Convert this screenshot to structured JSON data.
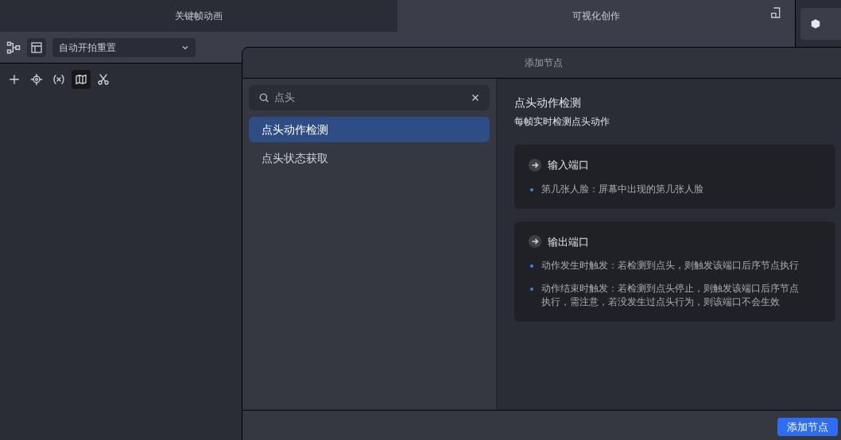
{
  "tabs": [
    {
      "label": "关键帧动画",
      "selected": false
    },
    {
      "label": "可视化创作",
      "selected": true
    }
  ],
  "toolbar": {
    "dropdown": "自动开拍重置"
  },
  "tools": [
    {
      "kind": "add",
      "selected": false
    },
    {
      "kind": "target",
      "selected": false
    },
    {
      "kind": "variable",
      "selected": false
    },
    {
      "kind": "map",
      "selected": true
    },
    {
      "kind": "cut",
      "selected": false
    }
  ],
  "dialog": {
    "title": "添加节点",
    "search": {
      "value": "点头"
    },
    "results": [
      {
        "label": "点头动作检测",
        "selected": true
      },
      {
        "label": "点头状态获取",
        "selected": false
      }
    ],
    "detail": {
      "title": "点头动作检测",
      "subtitle": "每帧实时检测点头动作",
      "sections": [
        {
          "title": "输入端口",
          "items": [
            "第几张人脸：屏幕中出现的第几张人脸"
          ]
        },
        {
          "title": "输出端口",
          "items": [
            "动作发生时触发：若检测到点头，则触发该端口后序节点执行",
            "动作结束时触发：若检测到点头停止，则触发该端口后序节点执行，需注意，若没发生过点头行为，则该端口不会生效"
          ]
        }
      ]
    },
    "button": "添加节点"
  }
}
